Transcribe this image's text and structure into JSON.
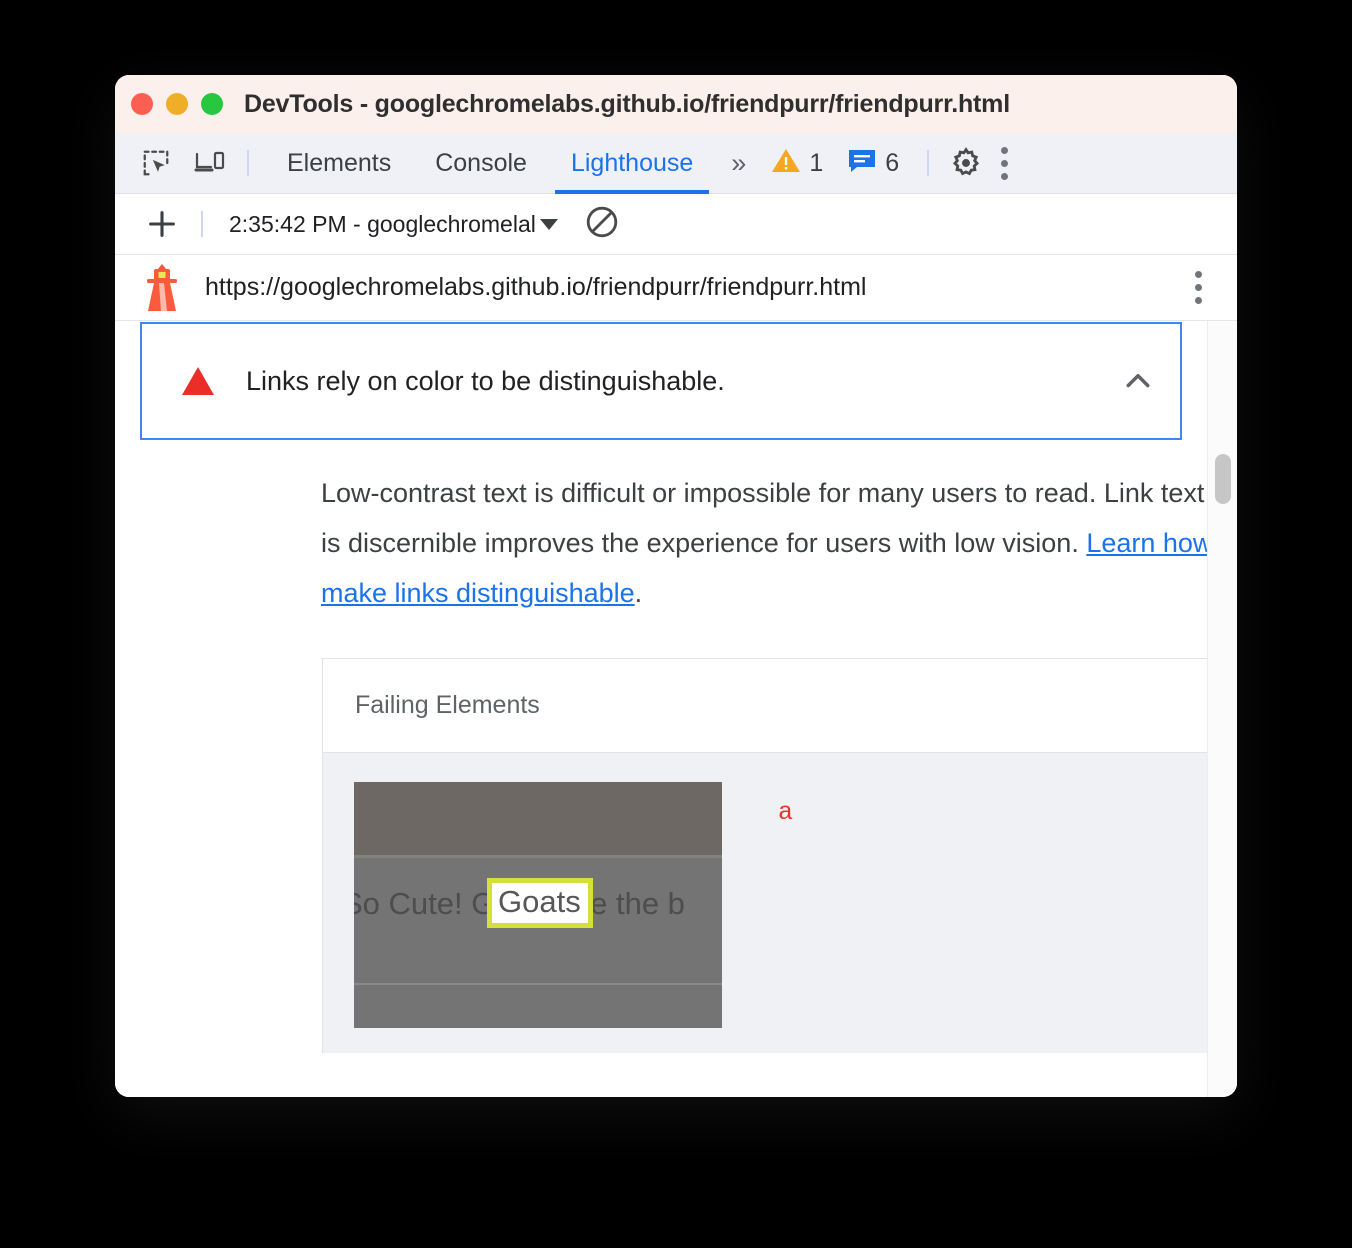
{
  "window": {
    "title": "DevTools - googlechromelabs.github.io/friendpurr/friendpurr.html",
    "traffic_lights": [
      {
        "name": "close",
        "color": "#fc5f52"
      },
      {
        "name": "minimize",
        "color": "#f0ad28"
      },
      {
        "name": "zoom",
        "color": "#27c840"
      }
    ]
  },
  "devtools": {
    "left_icons": [
      {
        "name": "inspect-element-icon",
        "label": "Inspect element"
      },
      {
        "name": "device-toolbar-icon",
        "label": "Toggle device toolbar"
      }
    ],
    "tabs": [
      {
        "label": "Elements",
        "active": false
      },
      {
        "label": "Console",
        "active": false
      },
      {
        "label": "Lighthouse",
        "active": true
      }
    ],
    "more_tabs_label": "»",
    "warnings": {
      "icon": "warning-triangle-icon",
      "count": "1"
    },
    "messages": {
      "icon": "message-icon",
      "count": "6"
    },
    "settings_icon": "gear-icon",
    "overflow_icon": "kebab-menu-icon",
    "accent_color": "#1a73e8"
  },
  "run_toolbar": {
    "new_audit_label": "+",
    "selected_run": "2:35:42 PM - googlechromelal",
    "clear_label": "Clear all",
    "clear_icon": "clear-circle-slash-icon"
  },
  "urlbar": {
    "logo_icon": "lighthouse-icon",
    "url": "https://googlechromelabs.github.io/friendpurr/friendpurr.html",
    "menu_icon": "kebab-menu-icon"
  },
  "audit": {
    "status_icon": "fail-triangle-icon",
    "title": "Links rely on color to be distinguishable.",
    "expanded": true,
    "toggle_icon": "chevron-up-icon",
    "description_before": "Low-contrast text is difficult or impossible for many users to read. Link text that is discernible improves the experience for users with low vision. ",
    "description_link": "Learn how to make links distinguishable",
    "description_after": ".",
    "border_color": "#4285f4"
  },
  "failing_elements": {
    "header": "Failing Elements",
    "rows": [
      {
        "thumbnail_text": "So Cute! Goats are the b",
        "thumbnail_highlight_text": "Goats",
        "highlight_color": "#d6e03a",
        "snippet": "a",
        "snippet_color": "#e8342a"
      }
    ]
  },
  "scrollbar": {
    "name": "vertical-scrollbar"
  }
}
